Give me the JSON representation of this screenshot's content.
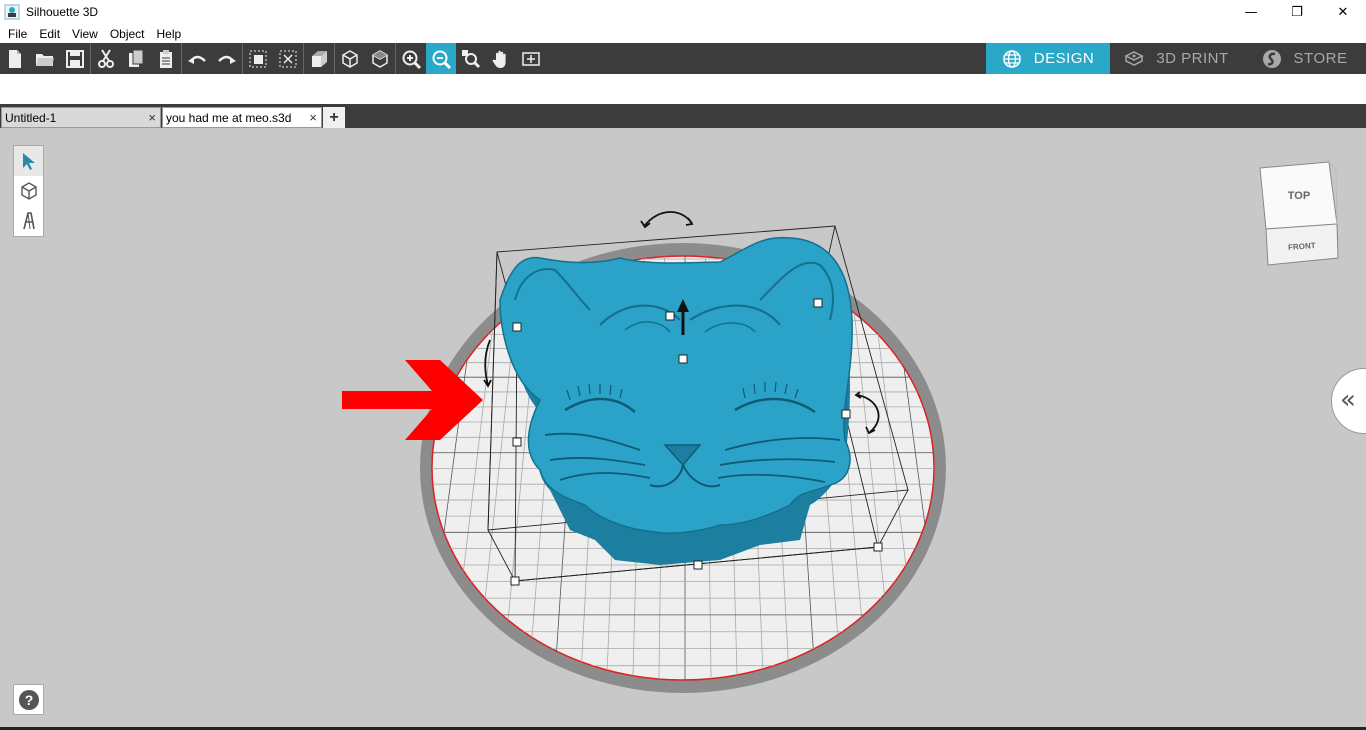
{
  "window": {
    "title": "Silhouette 3D",
    "minimize": "—",
    "restore": "❐",
    "close": "✕"
  },
  "menu": [
    "File",
    "Edit",
    "View",
    "Object",
    "Help"
  ],
  "toolbar": {
    "tools": [
      "new-document-icon",
      "open-folder-icon",
      "save-icon",
      "cut-icon",
      "copy-icon",
      "paste-icon",
      "undo-icon",
      "redo-icon",
      "group-icon",
      "ungroup-icon",
      "extrude-icon",
      "box-view-icon",
      "cube-view-icon",
      "zoom-in-icon",
      "zoom-out-icon",
      "zoom-fit-icon",
      "pan-hand-icon",
      "fit-page-icon"
    ],
    "active_tool": "zoom-out-icon"
  },
  "modes": [
    {
      "label": "DESIGN",
      "icon": "globe-icon",
      "active": true
    },
    {
      "label": "3D PRINT",
      "icon": "printer-icon",
      "active": false
    },
    {
      "label": "STORE",
      "icon": "store-icon",
      "active": false
    }
  ],
  "tabs": [
    {
      "label": "Untitled-1",
      "close": "×"
    },
    {
      "label": "you had me at meo.s3d",
      "close": "×"
    }
  ],
  "tab_add": "+",
  "view_cube": {
    "top": "TOP",
    "front": "FRONT"
  },
  "help": "?",
  "collapse": "«",
  "colors": {
    "accent": "#2aa8c8",
    "toolbar": "#3c3c3c",
    "model": "#2ba3c9",
    "viewport": "#c8c8c8",
    "arrow": "#ff0000"
  }
}
